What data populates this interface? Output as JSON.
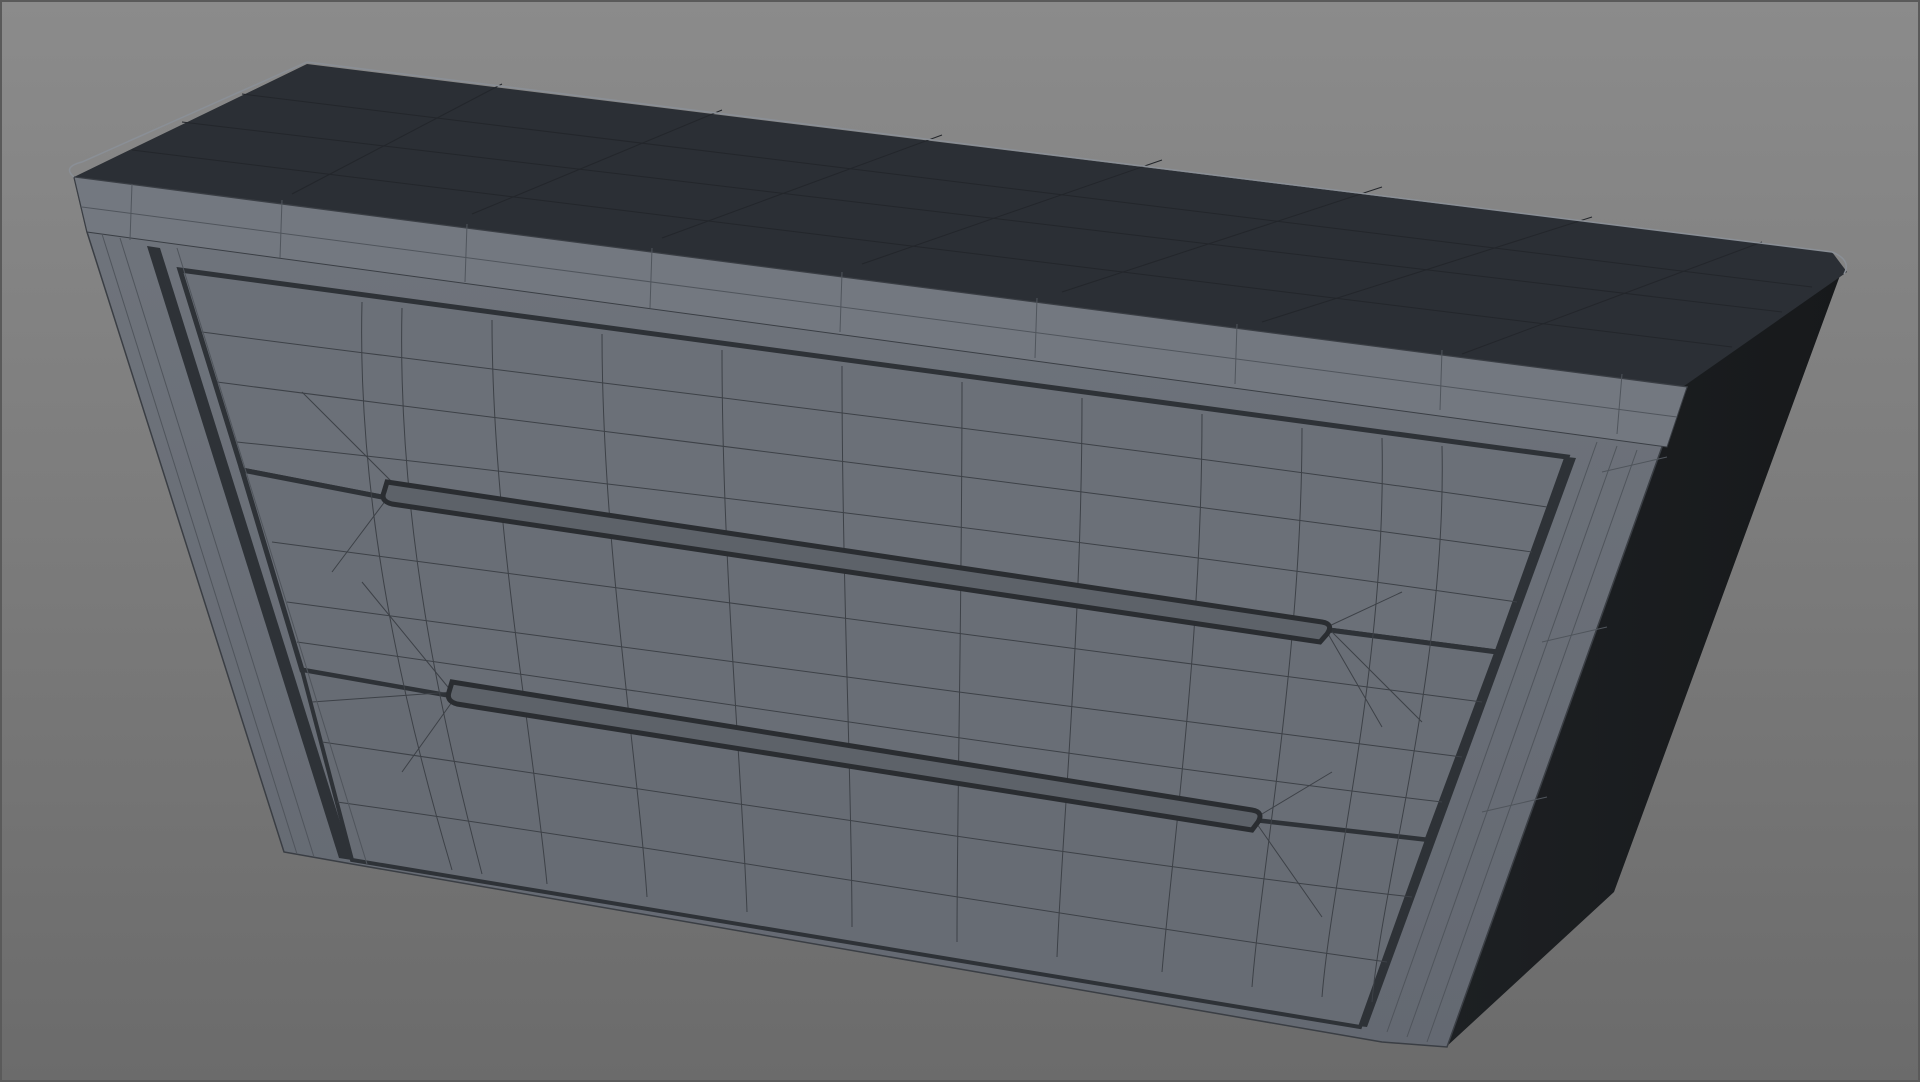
{
  "viewport": {
    "label": "",
    "background_top": "#8b8b8b",
    "background_bottom": "#6b6b6b",
    "border_color": "#5a5a5a"
  },
  "model": {
    "object": "chest-of-drawers-wireframe",
    "drawer_count": 2,
    "drawer_handle_count": 2,
    "colors": {
      "top_surface": "#2b2f35",
      "front_surface": "#6a6f77",
      "side_surface": "#1b1d20",
      "front_frame": "#737880",
      "groove": "#2e3237",
      "wire": "#2a2d31"
    },
    "icons": [
      "wireframe-mesh-icon"
    ]
  }
}
